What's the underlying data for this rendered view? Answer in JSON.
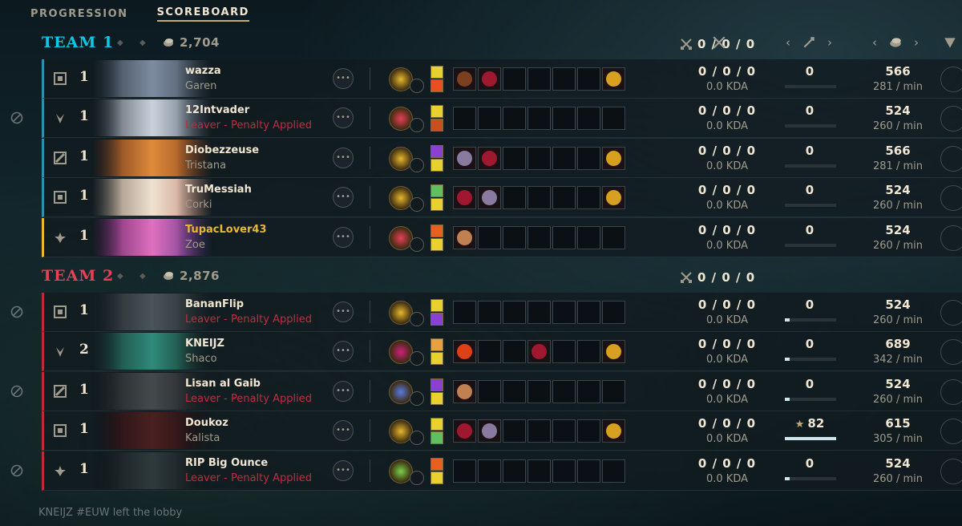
{
  "nav": {
    "tabs": [
      "PROGRESSION",
      "SCOREBOARD"
    ],
    "active": 1
  },
  "team1": {
    "name": "TEAM 1",
    "kda": "0 / 0 / 0",
    "gold": "2,704"
  },
  "team2": {
    "name": "TEAM 2",
    "kda": "0 / 0 / 0",
    "gold": "2,876"
  },
  "columns": {
    "kda_icon": "crossed-swords-icon",
    "cs_icon": "minion-sword-icon",
    "gold_icon": "gold-coins-icon",
    "extra_icon": "shield-icon"
  },
  "rows": [
    {
      "level": "1",
      "name": "wazza",
      "sub": "Garen",
      "leaver": false,
      "me": false,
      "kda": "0 / 0 / 0",
      "kda_sub": "0.0 KDA",
      "cs": "0",
      "cs_fill": 0.0,
      "gold": "566",
      "gold_rate": "281 / min"
    },
    {
      "level": "1",
      "name": "12Intvader",
      "sub": "Leaver - Penalty Applied",
      "leaver": true,
      "me": false,
      "kda": "0 / 0 / 0",
      "kda_sub": "0.0 KDA",
      "cs": "0",
      "cs_fill": 0.0,
      "gold": "524",
      "gold_rate": "260 / min"
    },
    {
      "level": "1",
      "name": "Diobezzeuse",
      "sub": "Tristana",
      "leaver": false,
      "me": false,
      "kda": "0 / 0 / 0",
      "kda_sub": "0.0 KDA",
      "cs": "0",
      "cs_fill": 0.0,
      "gold": "566",
      "gold_rate": "281 / min"
    },
    {
      "level": "1",
      "name": "TruMessiah",
      "sub": "Corki",
      "leaver": false,
      "me": false,
      "kda": "0 / 0 / 0",
      "kda_sub": "0.0 KDA",
      "cs": "0",
      "cs_fill": 0.0,
      "gold": "524",
      "gold_rate": "260 / min"
    },
    {
      "level": "1",
      "name": "TupacLover43",
      "sub": "Zoe",
      "leaver": false,
      "me": true,
      "kda": "0 / 0 / 0",
      "kda_sub": "0.0 KDA",
      "cs": "0",
      "cs_fill": 0.0,
      "gold": "524",
      "gold_rate": "260 / min"
    },
    {
      "level": "1",
      "name": "BananFlip",
      "sub": "Leaver - Penalty Applied",
      "leaver": true,
      "me": false,
      "kda": "0 / 0 / 0",
      "kda_sub": "0.0 KDA",
      "cs": "0",
      "cs_fill": 0.1,
      "gold": "524",
      "gold_rate": "260 / min"
    },
    {
      "level": "2",
      "name": "KNEIJZ",
      "sub": "Shaco",
      "leaver": false,
      "me": false,
      "kda": "0 / 0 / 0",
      "kda_sub": "0.0 KDA",
      "cs": "0",
      "cs_fill": 0.1,
      "gold": "689",
      "gold_rate": "342 / min"
    },
    {
      "level": "1",
      "name": "Lisan al Gaib",
      "sub": "Leaver - Penalty Applied",
      "leaver": true,
      "me": false,
      "kda": "0 / 0 / 0",
      "kda_sub": "0.0 KDA",
      "cs": "0",
      "cs_fill": 0.1,
      "gold": "524",
      "gold_rate": "260 / min"
    },
    {
      "level": "1",
      "name": "Doukoz",
      "sub": "Kalista",
      "leaver": false,
      "me": false,
      "kda": "0 / 0 / 0",
      "kda_sub": "0.0 KDA",
      "cs": "82",
      "cs_star": "★",
      "cs_fill": 1.0,
      "gold": "615",
      "gold_rate": "305 / min"
    },
    {
      "level": "1",
      "name": "RIP Big Ounce",
      "sub": "Leaver - Penalty Applied",
      "leaver": true,
      "me": false,
      "kda": "0 / 0 / 0",
      "kda_sub": "0.0 KDA",
      "cs": "0",
      "cs_fill": 0.1,
      "gold": "524",
      "gold_rate": "260 / min"
    }
  ],
  "footer": "KNEIJZ #EUW left the lobby"
}
